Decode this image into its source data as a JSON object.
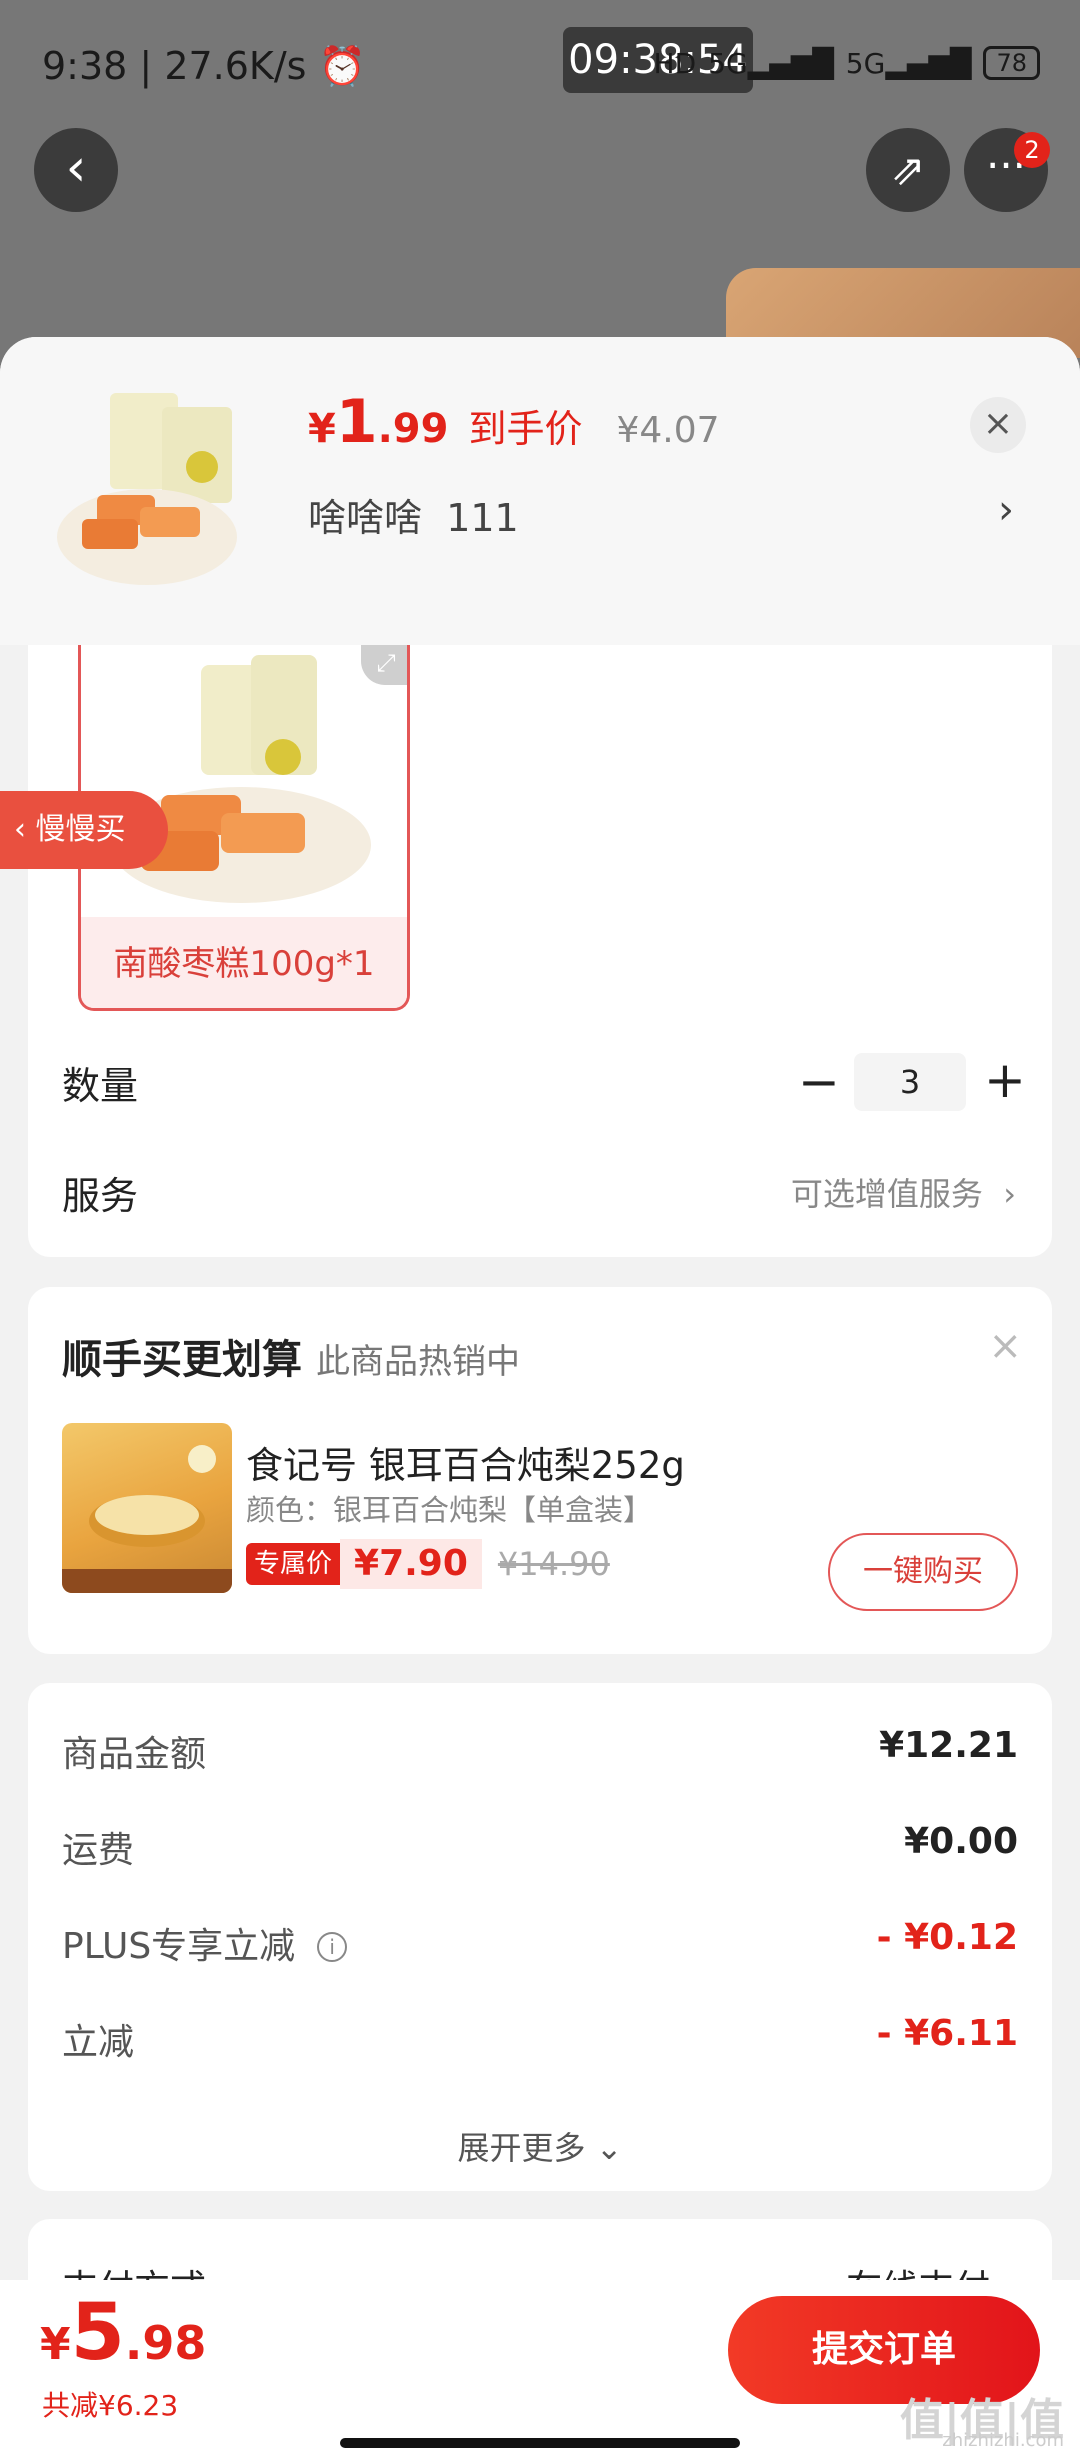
{
  "status_bar": {
    "time": "9:38",
    "speed": "27.6K/s",
    "clock_overlay": "09:38:54",
    "hd": "HD",
    "net1": "5G",
    "net2": "5G",
    "battery": "78"
  },
  "background": {
    "more_badge": "2"
  },
  "sheet": {
    "price": {
      "yen": "¥",
      "integer": "1",
      "decimal": ".99",
      "label": "到手价",
      "original": "¥4.07"
    },
    "address": {
      "name": "啥啥啥",
      "detail": "111"
    },
    "sku": {
      "label": "南酸枣糕100g*1"
    },
    "slow_buy": "慢慢买",
    "quantity": {
      "label": "数量",
      "value": "3"
    },
    "service": {
      "label": "服务",
      "value": "可选增值服务"
    }
  },
  "addon": {
    "title": "顺手买更划算",
    "subtitle": "此商品热销中",
    "product_name": "食记号 银耳百合炖梨252g",
    "product_color": "颜色：银耳百合炖梨【单盒装】",
    "price_tag": "专属价",
    "price": "¥7.90",
    "original_price": "¥14.90",
    "buy_button": "一键购买"
  },
  "summary": {
    "rows": [
      {
        "label": "商品金额",
        "value": "¥12.21"
      },
      {
        "label": "运费",
        "value": "¥0.00"
      },
      {
        "label": "PLUS专享立减",
        "value": "- ¥0.12"
      },
      {
        "label": "立减",
        "value": "- ¥6.11"
      }
    ],
    "expand": "展开更多"
  },
  "payment": {
    "label": "支付方式",
    "value": "在线支付"
  },
  "bottom": {
    "yen": "¥",
    "integer": "5",
    "decimal": ".98",
    "saved": "共减¥6.23",
    "submit": "提交订单"
  },
  "watermark": "值|值|值",
  "watermark_sub": "zhizhizhi.com",
  "colors": {
    "accent": "#e2231a",
    "sku_border": "#e35757"
  }
}
